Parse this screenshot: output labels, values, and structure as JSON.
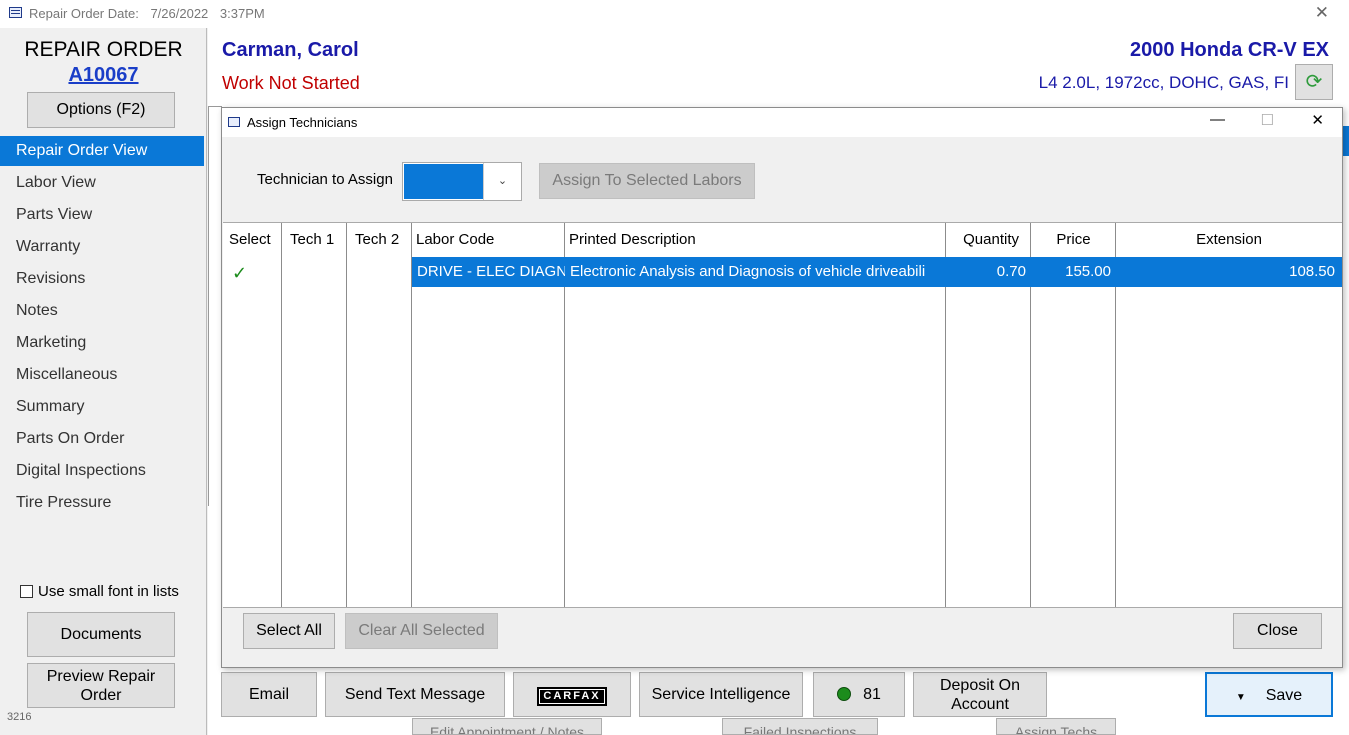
{
  "window": {
    "title_label": "Repair Order Date:",
    "date": "7/26/2022",
    "time": "3:37PM",
    "close_icon": "close-icon"
  },
  "sidebar": {
    "title": "REPAIR ORDER",
    "ro_number": "A10067",
    "options_button": "Options (F2)",
    "items": [
      {
        "label": "Repair Order View",
        "active": true
      },
      {
        "label": "Labor View"
      },
      {
        "label": "Parts View"
      },
      {
        "label": "Warranty"
      },
      {
        "label": "Revisions"
      },
      {
        "label": "Notes"
      },
      {
        "label": "Marketing"
      },
      {
        "label": "Miscellaneous"
      },
      {
        "label": "Summary"
      },
      {
        "label": "Parts On Order"
      },
      {
        "label": "Digital Inspections"
      },
      {
        "label": "Tire Pressure"
      }
    ],
    "small_font_checkbox": {
      "label": "Use small font in lists",
      "checked": false
    },
    "documents_button": "Documents",
    "preview_button_line1": "Preview Repair",
    "preview_button_line2": "Order",
    "version": "3216"
  },
  "header": {
    "customer": "Carman, Carol",
    "status": "Work Not Started",
    "vehicle": "2000 Honda  CR-V EX",
    "engine": "L4 2.0L, 1972cc, DOHC, GAS, FI",
    "refresh_icon": "refresh-icon"
  },
  "dialog": {
    "title": "Assign Technicians",
    "minimize_icon": "minimize-icon",
    "maximize_icon": "maximize-icon",
    "close_icon": "close-icon",
    "tech_label": "Technician to Assign",
    "tech_value": "",
    "assign_button": "Assign To Selected Labors",
    "columns": [
      "Select",
      "Tech 1",
      "Tech 2",
      "Labor Code",
      "Printed Description",
      "Quantity",
      "Price",
      "Extension"
    ],
    "rows": [
      {
        "selected": true,
        "tech1": "",
        "tech2": "",
        "labor_code": "DRIVE - ELEC DIAGN",
        "description": "Electronic Analysis and Diagnosis of vehicle driveabili",
        "quantity": "0.70",
        "price": "155.00",
        "extension": "108.50"
      }
    ],
    "select_all_button": "Select All",
    "clear_button": "Clear All Selected",
    "close_button": "Close"
  },
  "bottom_bar": {
    "email": "Email",
    "send_text": "Send Text Message",
    "carfax": "CARFAX",
    "service_intelligence": "Service Intelligence",
    "count": "81",
    "deposit_line1": "Deposit On",
    "deposit_line2": "Account",
    "save": "Save",
    "peek_1": "Edit Appointment / Notes",
    "peek_2": "Failed Inspections",
    "peek_3": "Assign Techs"
  },
  "colors": {
    "accent": "#0a78d7",
    "customer_text": "#1a1aa8",
    "status_text": "#c00000",
    "check_green": "#1c8c1c"
  }
}
